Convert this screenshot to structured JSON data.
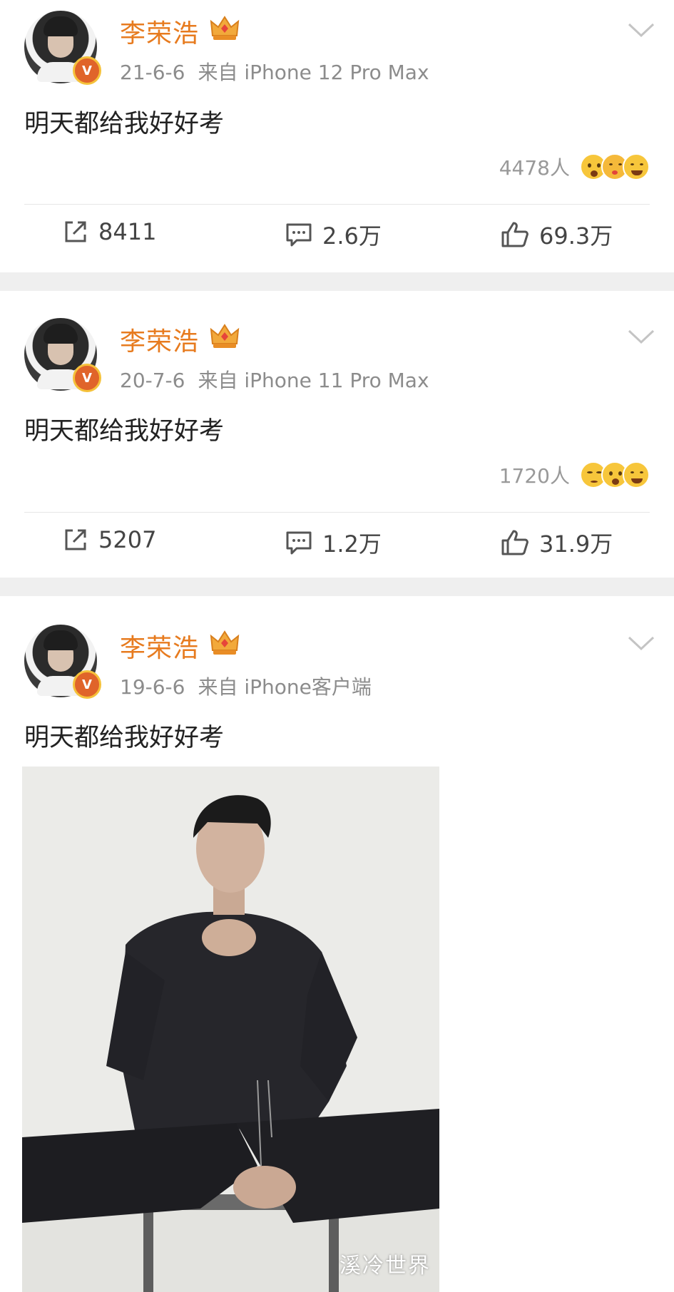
{
  "posts": [
    {
      "author": "李荣浩",
      "date": "21-6-6",
      "source": "来自 iPhone 12 Pro Max",
      "text": "明天都给我好好考",
      "reaction_count": "4478人",
      "reposts": "8411",
      "comments": "2.6万",
      "likes": "69.3万"
    },
    {
      "author": "李荣浩",
      "date": "20-7-6",
      "source": "来自 iPhone 11 Pro Max",
      "text": "明天都给我好好考",
      "reaction_count": "1720人",
      "reposts": "5207",
      "comments": "1.2万",
      "likes": "31.9万"
    },
    {
      "author": "李荣浩",
      "date": "19-6-6",
      "source": "来自 iPhone客户端",
      "text": "明天都给我好好考"
    }
  ],
  "verified_badge": "V",
  "watermark": "溪冷世界",
  "colors": {
    "author_name": "#e77b1f",
    "meta_text": "#8c8c8c",
    "separator": "#efefef",
    "verified_badge": "#e0642a"
  },
  "icons": [
    "crown-icon",
    "chevron-down-icon",
    "repost-icon",
    "comment-icon",
    "like-icon",
    "verified-badge-icon"
  ]
}
